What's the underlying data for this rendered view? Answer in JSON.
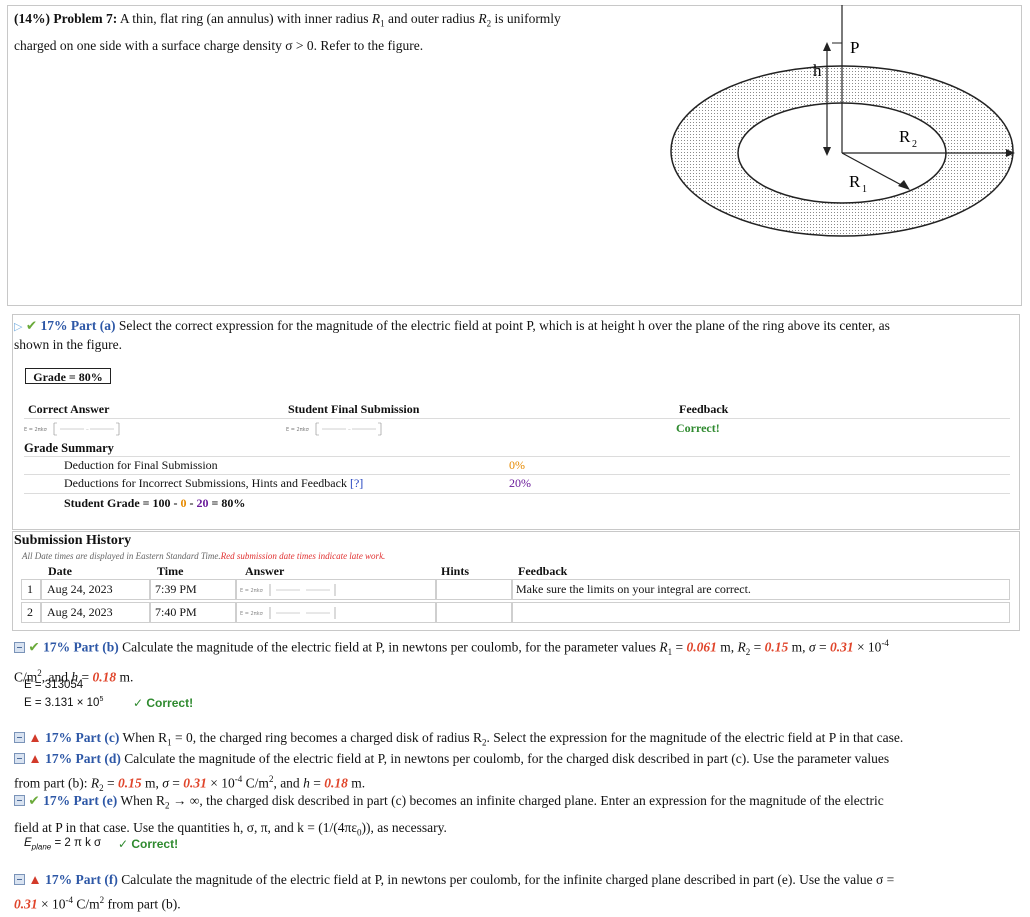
{
  "problem": {
    "header": "(14%) Problem 7:",
    "text1": "A thin, flat ring (an annulus) with inner radius ",
    "text2": " and outer radius ",
    "text3": " is uniformly",
    "text4": "charged on one side with a surface charge density σ > 0. Refer to the figure.",
    "figure": {
      "label_P": "P",
      "label_h": "h",
      "label_R1": "R",
      "label_R2": "R",
      "sub1": "1",
      "sub2": "2"
    }
  },
  "part_a": {
    "title": "17% Part (a)",
    "text": "Select the correct expression for the magnitude of the electric field at point P, which is at height h over the plane of the ring above its center, as",
    "text_cont": "shown in the figure.",
    "grade_box": "Grade = 80%",
    "headers": {
      "correct_answer": "Correct Answer",
      "student_final": "Student Final Submission",
      "feedback": "Feedback"
    },
    "feedback_value": "Correct!",
    "grade_summary": "Grade Summary",
    "deduction_final": "Deduction for Final Submission",
    "deduction_final_value": "0%",
    "deduction_incorrect": "Deductions for Incorrect Submissions, Hints and Feedback",
    "help_link": "[?]",
    "deduction_incorrect_value": "20%",
    "student_grade_prefix": "Student Grade = 100 - ",
    "student_grade_zero": "0",
    "student_grade_mid": " - ",
    "student_grade_twenty": "20",
    "student_grade_suffix": " = 80%"
  },
  "history": {
    "title": "Submission History",
    "note": "All Date times are displayed in Eastern Standard Time.",
    "note_red": "Red submission date times indicate late work.",
    "headers": {
      "date": "Date",
      "time": "Time",
      "answer": "Answer",
      "hints": "Hints",
      "feedback": "Feedback"
    },
    "rows": [
      {
        "num": "1",
        "date": "Aug 24, 2023",
        "time": "7:39 PM",
        "feedback": "Make sure the limits on your integral are correct."
      },
      {
        "num": "2",
        "date": "Aug 24, 2023",
        "time": "7:40 PM",
        "feedback": ""
      }
    ]
  },
  "part_b": {
    "title": "17% Part (b)",
    "text": "Calculate the magnitude of the electric field at P, in newtons per coulomb, for the parameter values ",
    "r1_value": "0.061",
    "r2_value": "0.15",
    "sigma_value": "0.31",
    "h_value": "0.18",
    "answer1": "E = 313054",
    "answer2": "E = 3.131 × 10",
    "answer2_exp": "5",
    "correct": "✓ Correct!"
  },
  "part_c": {
    "title": "17% Part (c)",
    "text": "When R",
    "text2": " = 0, the charged ring becomes a charged disk of radius R",
    "text3": ". Select the expression for the magnitude of the electric field at P in that case."
  },
  "part_d": {
    "title": "17% Part (d)",
    "text": "Calculate the magnitude of the electric field at P, in newtons per coulomb, for the charged disk described in part (c). Use the parameter values",
    "text_cont": "from part (b): ",
    "r2_value": "0.15",
    "sigma_value": "0.31",
    "h_value": "0.18"
  },
  "part_e": {
    "title": "17% Part (e)",
    "text": "When R",
    "text2": " → ∞, the charged disk described in part (c) becomes an infinite charged plane. Enter an expression for the magnitude of the electric",
    "text_cont": "field at P in that case. Use the quantities h, σ, π, and k = (1/(4πε",
    "text_cont2": ")), as necessary.",
    "answer": "= 2 π k σ",
    "correct": "✓ Correct!"
  },
  "part_f": {
    "title": "17% Part (f)",
    "text": "Calculate the magnitude of the electric field at P, in newtons per coulomb, for the infinite charged plane described in part (e). Use the value σ =",
    "sigma_value": "0.31",
    "text_cont": " × 10",
    "exp": "-4",
    "text_cont2": " C/m",
    "text_cont3": " from part (b)."
  }
}
